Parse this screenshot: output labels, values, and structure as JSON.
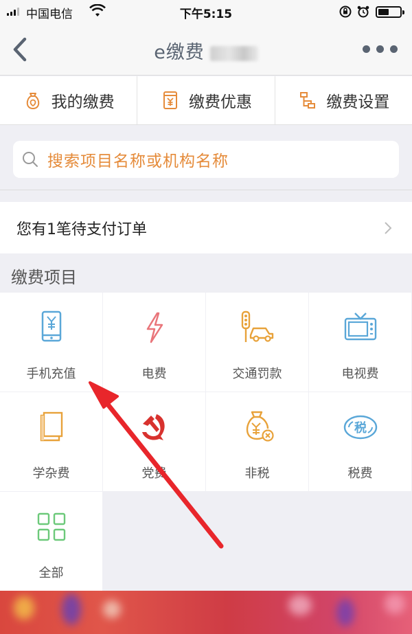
{
  "status_bar": {
    "carrier": "中国电信",
    "time": "下午5:15"
  },
  "nav": {
    "title": "e缴费"
  },
  "func_tabs": [
    {
      "label": "我的缴费",
      "icon": "wallet-bag-icon"
    },
    {
      "label": "缴费优惠",
      "icon": "coupon-icon"
    },
    {
      "label": "缴费设置",
      "icon": "settings-node-icon"
    }
  ],
  "search": {
    "placeholder": "搜索项目名称或机构名称"
  },
  "pending": {
    "text": "您有1笔待支付订单"
  },
  "section": {
    "title": "缴费项目"
  },
  "items": [
    {
      "label": "手机充值",
      "icon": "phone-topup-icon"
    },
    {
      "label": "电费",
      "icon": "lightning-icon"
    },
    {
      "label": "交通罚款",
      "icon": "traffic-fine-icon"
    },
    {
      "label": "电视费",
      "icon": "tv-icon"
    },
    {
      "label": "学杂费",
      "icon": "books-icon"
    },
    {
      "label": "党费",
      "icon": "party-emblem-icon"
    },
    {
      "label": "非税",
      "icon": "money-bag-icon"
    },
    {
      "label": "税费",
      "icon": "tax-icon"
    },
    {
      "label": "全部",
      "icon": "grid-all-icon"
    }
  ],
  "colors": {
    "accent_orange": "#e58b3a",
    "nav_text": "#5a6472",
    "annotation_red": "#e8262b"
  }
}
